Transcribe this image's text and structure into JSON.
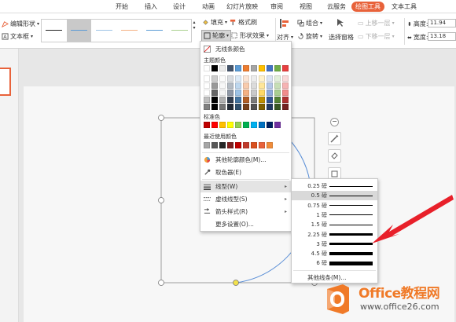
{
  "ribbon": {
    "tabs": [
      {
        "label": "开始"
      },
      {
        "label": "插入"
      },
      {
        "label": "设计"
      },
      {
        "label": "动画"
      },
      {
        "label": "幻灯片放映"
      },
      {
        "label": "审阅"
      },
      {
        "label": "视图"
      },
      {
        "label": "云服务"
      },
      {
        "label": "绘图工具"
      },
      {
        "label": "文本工具"
      }
    ],
    "active_tab": "绘图工具",
    "accent": "#e8623a"
  },
  "toolbar": {
    "edit_shape": "编辑形状",
    "textbox": "文本框",
    "fill": "填充",
    "format_painter": "格式刷",
    "outline": "轮廓",
    "shape_effects": "形状效果",
    "align": "对齐",
    "group": "组合",
    "rotate": "旋转",
    "selection_pane": "选择窗格",
    "bring_forward": "上移一层",
    "send_backward": "下移一层",
    "height_label": "高度:",
    "width_label": "宽度:",
    "height_value": "11.94",
    "width_value": "13.18"
  },
  "outline_menu": {
    "no_outline": "无线条颜色",
    "theme_colors_title": "主题颜色",
    "standard_colors_title": "标准色",
    "recent_colors_title": "最近使用颜色",
    "more_colors": "其他轮廓颜色(M)...",
    "eyedropper": "取色器(E)",
    "line_style": "线型(W)",
    "dash_style": "虚线线型(S)",
    "arrow_style": "箭头样式(R)",
    "more_settings": "更多设置(O)...",
    "theme_top_row": [
      "#ffffff",
      "#000000",
      "#ececec",
      "#44546a",
      "#5b9bd5",
      "#ed7d31",
      "#a5a5a5",
      "#ffc000",
      "#4472c4",
      "#70ad47",
      "#e84040"
    ],
    "standard_colors": [
      "#c00000",
      "#ff0000",
      "#ffc000",
      "#ffff00",
      "#92d050",
      "#00b050",
      "#00b0f0",
      "#0070c0",
      "#002060",
      "#7030a0"
    ],
    "recent_colors": [
      "#a6a6a6",
      "#595959",
      "#262626",
      "#7f1f1f",
      "#c00000",
      "#c0392b",
      "#d9501e",
      "#e8623a",
      "#f08c3a"
    ]
  },
  "line_weight_menu": {
    "items": [
      {
        "label": "0.25 磅",
        "weight": 0.25
      },
      {
        "label": "0.5 磅",
        "weight": 0.5
      },
      {
        "label": "0.75 磅",
        "weight": 0.75
      },
      {
        "label": "1 磅",
        "weight": 1
      },
      {
        "label": "1.5 磅",
        "weight": 1.5
      },
      {
        "label": "2.25 磅",
        "weight": 2.25
      },
      {
        "label": "3 磅",
        "weight": 3
      },
      {
        "label": "4.5 磅",
        "weight": 4.5
      },
      {
        "label": "6 磅",
        "weight": 6
      }
    ],
    "selected_label": "0.5 磅",
    "more_lines": "其他线条(M)..."
  },
  "watermark": {
    "title": "Office教程网",
    "url": "www.office26.com",
    "color": "#f07a28"
  },
  "annotation_arrow_color": "#e8202a"
}
